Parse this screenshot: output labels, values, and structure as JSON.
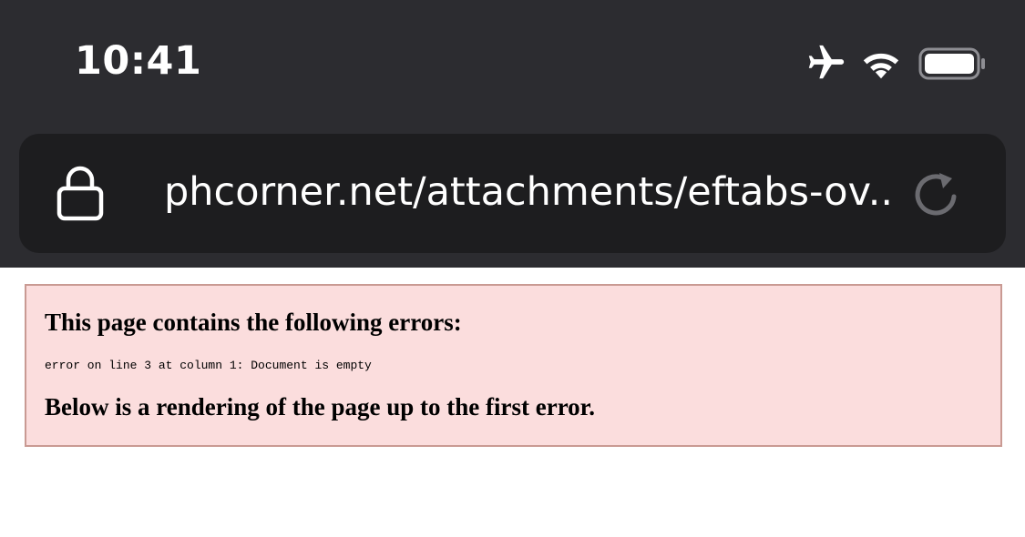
{
  "status_bar": {
    "time": "10:41",
    "icons": [
      "airplane-icon",
      "wifi-icon",
      "battery-icon"
    ]
  },
  "address_bar": {
    "url": "phcorner.net/attachments/eftabs-ov...",
    "icons": [
      "lock-icon",
      "reload-icon"
    ]
  },
  "error": {
    "heading": "This page contains the following errors:",
    "message": "error on line 3 at column 1: Document is empty",
    "footer": "Below is a rendering of the page up to the first error."
  },
  "colors": {
    "chrome_background": "#2c2c30",
    "url_bar_background": "#1d1d1f",
    "error_background": "#fbdddd",
    "error_border": "#c99a93"
  }
}
